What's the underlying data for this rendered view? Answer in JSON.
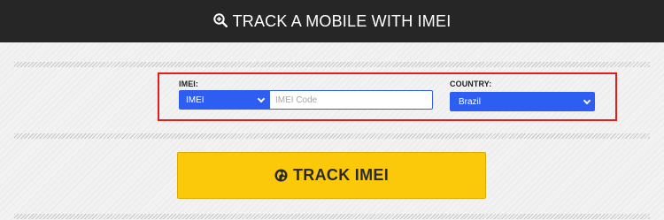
{
  "header": {
    "title": "TRACK A MOBILE WITH IMEI",
    "icon": "zoom-search-icon"
  },
  "form": {
    "imei_label": "IMEI:",
    "imei_type_selected": "IMEI",
    "imei_placeholder": "IMEI Code",
    "imei_value": "",
    "country_label": "COUNTRY:",
    "country_selected": "Brazil"
  },
  "button": {
    "label": "TRACK IMEI",
    "icon": "globe-icon"
  },
  "colors": {
    "header_bg": "#262626",
    "accent_blue": "#2e5df2",
    "highlight_border": "#e31c1c",
    "button_yellow": "#fcc80a"
  }
}
